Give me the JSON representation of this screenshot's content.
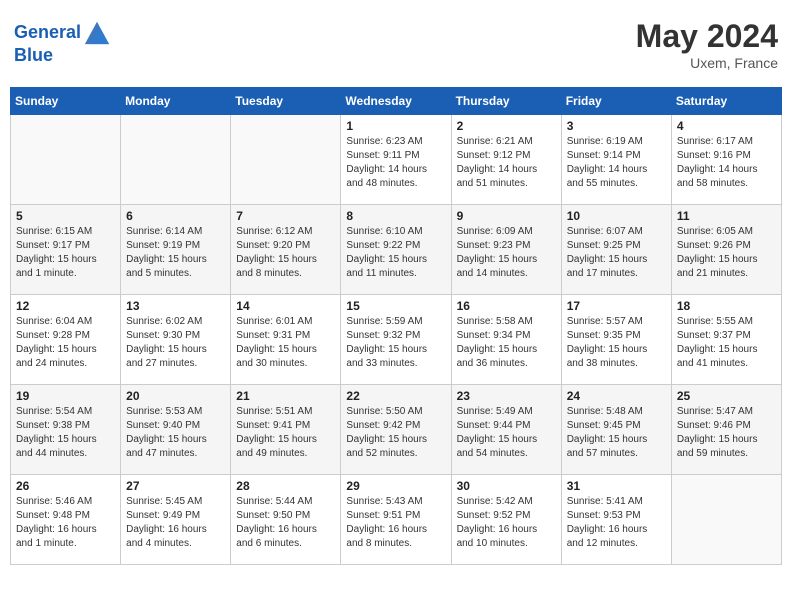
{
  "header": {
    "logo_general": "General",
    "logo_blue": "Blue",
    "month_year": "May 2024",
    "location": "Uxem, France"
  },
  "days_of_week": [
    "Sunday",
    "Monday",
    "Tuesday",
    "Wednesday",
    "Thursday",
    "Friday",
    "Saturday"
  ],
  "weeks": [
    [
      {
        "day": "",
        "empty": true
      },
      {
        "day": "",
        "empty": true
      },
      {
        "day": "",
        "empty": true
      },
      {
        "day": "1",
        "sunrise": "6:23 AM",
        "sunset": "9:11 PM",
        "daylight": "14 hours and 48 minutes."
      },
      {
        "day": "2",
        "sunrise": "6:21 AM",
        "sunset": "9:12 PM",
        "daylight": "14 hours and 51 minutes."
      },
      {
        "day": "3",
        "sunrise": "6:19 AM",
        "sunset": "9:14 PM",
        "daylight": "14 hours and 55 minutes."
      },
      {
        "day": "4",
        "sunrise": "6:17 AM",
        "sunset": "9:16 PM",
        "daylight": "14 hours and 58 minutes."
      }
    ],
    [
      {
        "day": "5",
        "sunrise": "6:15 AM",
        "sunset": "9:17 PM",
        "daylight": "15 hours and 1 minute."
      },
      {
        "day": "6",
        "sunrise": "6:14 AM",
        "sunset": "9:19 PM",
        "daylight": "15 hours and 5 minutes."
      },
      {
        "day": "7",
        "sunrise": "6:12 AM",
        "sunset": "9:20 PM",
        "daylight": "15 hours and 8 minutes."
      },
      {
        "day": "8",
        "sunrise": "6:10 AM",
        "sunset": "9:22 PM",
        "daylight": "15 hours and 11 minutes."
      },
      {
        "day": "9",
        "sunrise": "6:09 AM",
        "sunset": "9:23 PM",
        "daylight": "15 hours and 14 minutes."
      },
      {
        "day": "10",
        "sunrise": "6:07 AM",
        "sunset": "9:25 PM",
        "daylight": "15 hours and 17 minutes."
      },
      {
        "day": "11",
        "sunrise": "6:05 AM",
        "sunset": "9:26 PM",
        "daylight": "15 hours and 21 minutes."
      }
    ],
    [
      {
        "day": "12",
        "sunrise": "6:04 AM",
        "sunset": "9:28 PM",
        "daylight": "15 hours and 24 minutes."
      },
      {
        "day": "13",
        "sunrise": "6:02 AM",
        "sunset": "9:30 PM",
        "daylight": "15 hours and 27 minutes."
      },
      {
        "day": "14",
        "sunrise": "6:01 AM",
        "sunset": "9:31 PM",
        "daylight": "15 hours and 30 minutes."
      },
      {
        "day": "15",
        "sunrise": "5:59 AM",
        "sunset": "9:32 PM",
        "daylight": "15 hours and 33 minutes."
      },
      {
        "day": "16",
        "sunrise": "5:58 AM",
        "sunset": "9:34 PM",
        "daylight": "15 hours and 36 minutes."
      },
      {
        "day": "17",
        "sunrise": "5:57 AM",
        "sunset": "9:35 PM",
        "daylight": "15 hours and 38 minutes."
      },
      {
        "day": "18",
        "sunrise": "5:55 AM",
        "sunset": "9:37 PM",
        "daylight": "15 hours and 41 minutes."
      }
    ],
    [
      {
        "day": "19",
        "sunrise": "5:54 AM",
        "sunset": "9:38 PM",
        "daylight": "15 hours and 44 minutes."
      },
      {
        "day": "20",
        "sunrise": "5:53 AM",
        "sunset": "9:40 PM",
        "daylight": "15 hours and 47 minutes."
      },
      {
        "day": "21",
        "sunrise": "5:51 AM",
        "sunset": "9:41 PM",
        "daylight": "15 hours and 49 minutes."
      },
      {
        "day": "22",
        "sunrise": "5:50 AM",
        "sunset": "9:42 PM",
        "daylight": "15 hours and 52 minutes."
      },
      {
        "day": "23",
        "sunrise": "5:49 AM",
        "sunset": "9:44 PM",
        "daylight": "15 hours and 54 minutes."
      },
      {
        "day": "24",
        "sunrise": "5:48 AM",
        "sunset": "9:45 PM",
        "daylight": "15 hours and 57 minutes."
      },
      {
        "day": "25",
        "sunrise": "5:47 AM",
        "sunset": "9:46 PM",
        "daylight": "15 hours and 59 minutes."
      }
    ],
    [
      {
        "day": "26",
        "sunrise": "5:46 AM",
        "sunset": "9:48 PM",
        "daylight": "16 hours and 1 minute."
      },
      {
        "day": "27",
        "sunrise": "5:45 AM",
        "sunset": "9:49 PM",
        "daylight": "16 hours and 4 minutes."
      },
      {
        "day": "28",
        "sunrise": "5:44 AM",
        "sunset": "9:50 PM",
        "daylight": "16 hours and 6 minutes."
      },
      {
        "day": "29",
        "sunrise": "5:43 AM",
        "sunset": "9:51 PM",
        "daylight": "16 hours and 8 minutes."
      },
      {
        "day": "30",
        "sunrise": "5:42 AM",
        "sunset": "9:52 PM",
        "daylight": "16 hours and 10 minutes."
      },
      {
        "day": "31",
        "sunrise": "5:41 AM",
        "sunset": "9:53 PM",
        "daylight": "16 hours and 12 minutes."
      },
      {
        "day": "",
        "empty": true
      }
    ]
  ]
}
